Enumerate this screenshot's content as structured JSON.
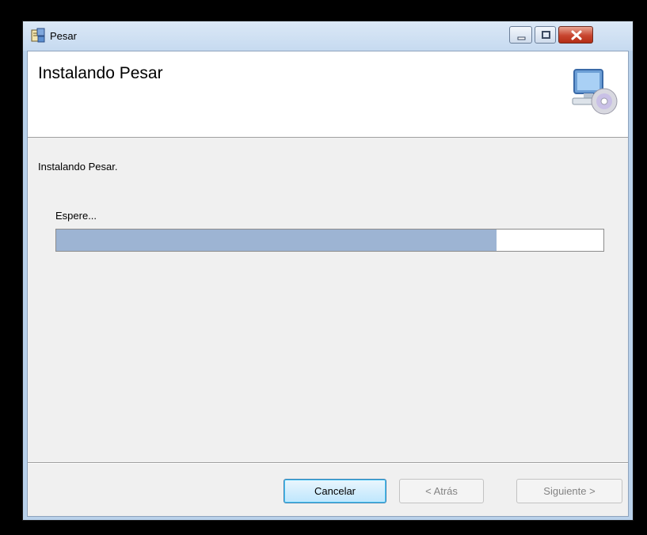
{
  "window": {
    "title": "Pesar",
    "controls": {
      "minimize": "minimize-icon",
      "maximize": "maximize-icon",
      "close": "close-icon"
    }
  },
  "banner": {
    "title": "Instalando Pesar",
    "icon": "computer-cd-icon"
  },
  "body": {
    "status": "Instalando Pesar.",
    "wait_label": "Espere...",
    "progress": 0.805
  },
  "buttons": {
    "cancel": "Cancelar",
    "back": "< Atrás",
    "next": "Siguiente >"
  },
  "colors": {
    "progress_fill": "#9db4d3",
    "client_bg": "#f0f0f0",
    "close_button": "#c7452f"
  }
}
